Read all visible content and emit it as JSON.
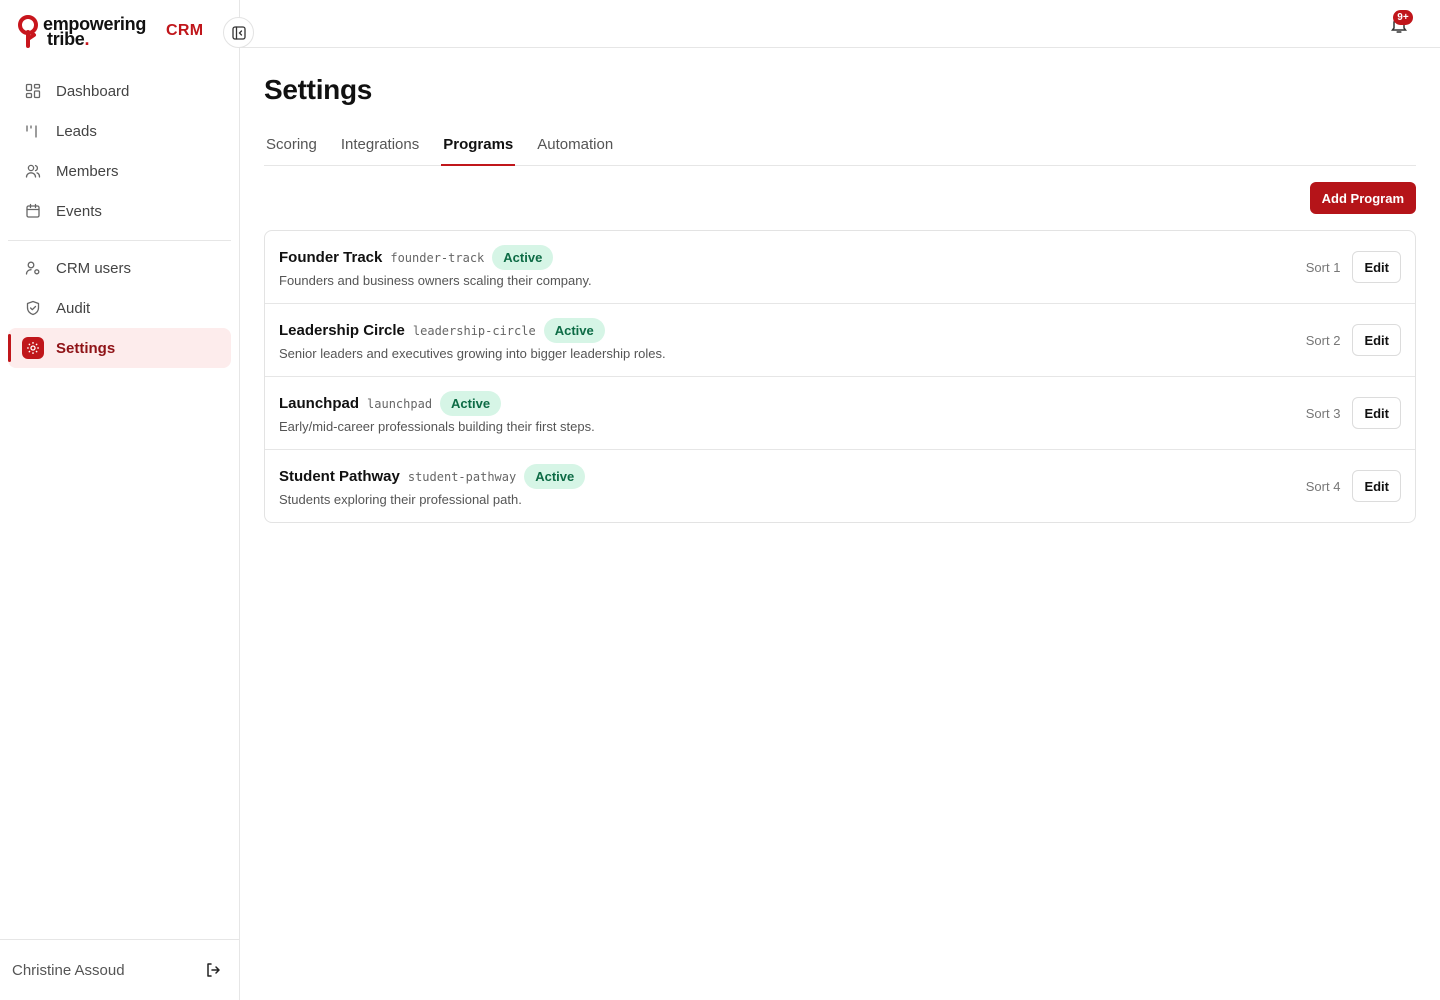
{
  "brand": {
    "line1": "empowering",
    "line2": "tribe",
    "dot": ".",
    "app_label": "CRM",
    "accent": "#c0161b"
  },
  "sidebar": {
    "primary": [
      {
        "label": "Dashboard",
        "icon": "dashboard-icon"
      },
      {
        "label": "Leads",
        "icon": "leads-icon"
      },
      {
        "label": "Members",
        "icon": "members-icon"
      },
      {
        "label": "Events",
        "icon": "calendar-icon"
      }
    ],
    "secondary": [
      {
        "label": "CRM users",
        "icon": "user-settings-icon"
      },
      {
        "label": "Audit",
        "icon": "shield-icon"
      },
      {
        "label": "Settings",
        "icon": "gear-icon",
        "active": true
      }
    ],
    "user_name": "Christine Assoud"
  },
  "topbar": {
    "notification_badge": "9+"
  },
  "page": {
    "title": "Settings",
    "tabs": [
      {
        "label": "Scoring"
      },
      {
        "label": "Integrations"
      },
      {
        "label": "Programs",
        "active": true
      },
      {
        "label": "Automation"
      }
    ],
    "add_button": "Add Program"
  },
  "programs": [
    {
      "name": "Founder Track",
      "slug": "founder-track",
      "status": "Active",
      "description": "Founders and business owners scaling their company.",
      "sort": "Sort 1",
      "edit": "Edit"
    },
    {
      "name": "Leadership Circle",
      "slug": "leadership-circle",
      "status": "Active",
      "description": "Senior leaders and executives growing into bigger leadership roles.",
      "sort": "Sort 2",
      "edit": "Edit"
    },
    {
      "name": "Launchpad",
      "slug": "launchpad",
      "status": "Active",
      "description": "Early/mid-career professionals building their first steps.",
      "sort": "Sort 3",
      "edit": "Edit"
    },
    {
      "name": "Student Pathway",
      "slug": "student-pathway",
      "status": "Active",
      "description": "Students exploring their professional path.",
      "sort": "Sort 4",
      "edit": "Edit"
    }
  ]
}
